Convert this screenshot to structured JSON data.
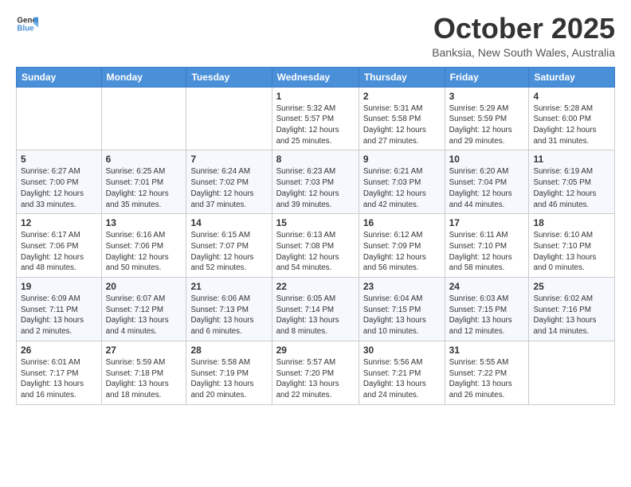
{
  "header": {
    "logo_text_general": "General",
    "logo_text_blue": "Blue",
    "month": "October 2025",
    "location": "Banksia, New South Wales, Australia"
  },
  "days_of_week": [
    "Sunday",
    "Monday",
    "Tuesday",
    "Wednesday",
    "Thursday",
    "Friday",
    "Saturday"
  ],
  "weeks": [
    {
      "days": [
        {
          "num": "",
          "info": ""
        },
        {
          "num": "",
          "info": ""
        },
        {
          "num": "",
          "info": ""
        },
        {
          "num": "1",
          "info": "Sunrise: 5:32 AM\nSunset: 5:57 PM\nDaylight: 12 hours\nand 25 minutes."
        },
        {
          "num": "2",
          "info": "Sunrise: 5:31 AM\nSunset: 5:58 PM\nDaylight: 12 hours\nand 27 minutes."
        },
        {
          "num": "3",
          "info": "Sunrise: 5:29 AM\nSunset: 5:59 PM\nDaylight: 12 hours\nand 29 minutes."
        },
        {
          "num": "4",
          "info": "Sunrise: 5:28 AM\nSunset: 6:00 PM\nDaylight: 12 hours\nand 31 minutes."
        }
      ]
    },
    {
      "days": [
        {
          "num": "5",
          "info": "Sunrise: 6:27 AM\nSunset: 7:00 PM\nDaylight: 12 hours\nand 33 minutes."
        },
        {
          "num": "6",
          "info": "Sunrise: 6:25 AM\nSunset: 7:01 PM\nDaylight: 12 hours\nand 35 minutes."
        },
        {
          "num": "7",
          "info": "Sunrise: 6:24 AM\nSunset: 7:02 PM\nDaylight: 12 hours\nand 37 minutes."
        },
        {
          "num": "8",
          "info": "Sunrise: 6:23 AM\nSunset: 7:03 PM\nDaylight: 12 hours\nand 39 minutes."
        },
        {
          "num": "9",
          "info": "Sunrise: 6:21 AM\nSunset: 7:03 PM\nDaylight: 12 hours\nand 42 minutes."
        },
        {
          "num": "10",
          "info": "Sunrise: 6:20 AM\nSunset: 7:04 PM\nDaylight: 12 hours\nand 44 minutes."
        },
        {
          "num": "11",
          "info": "Sunrise: 6:19 AM\nSunset: 7:05 PM\nDaylight: 12 hours\nand 46 minutes."
        }
      ]
    },
    {
      "days": [
        {
          "num": "12",
          "info": "Sunrise: 6:17 AM\nSunset: 7:06 PM\nDaylight: 12 hours\nand 48 minutes."
        },
        {
          "num": "13",
          "info": "Sunrise: 6:16 AM\nSunset: 7:06 PM\nDaylight: 12 hours\nand 50 minutes."
        },
        {
          "num": "14",
          "info": "Sunrise: 6:15 AM\nSunset: 7:07 PM\nDaylight: 12 hours\nand 52 minutes."
        },
        {
          "num": "15",
          "info": "Sunrise: 6:13 AM\nSunset: 7:08 PM\nDaylight: 12 hours\nand 54 minutes."
        },
        {
          "num": "16",
          "info": "Sunrise: 6:12 AM\nSunset: 7:09 PM\nDaylight: 12 hours\nand 56 minutes."
        },
        {
          "num": "17",
          "info": "Sunrise: 6:11 AM\nSunset: 7:10 PM\nDaylight: 12 hours\nand 58 minutes."
        },
        {
          "num": "18",
          "info": "Sunrise: 6:10 AM\nSunset: 7:10 PM\nDaylight: 13 hours\nand 0 minutes."
        }
      ]
    },
    {
      "days": [
        {
          "num": "19",
          "info": "Sunrise: 6:09 AM\nSunset: 7:11 PM\nDaylight: 13 hours\nand 2 minutes."
        },
        {
          "num": "20",
          "info": "Sunrise: 6:07 AM\nSunset: 7:12 PM\nDaylight: 13 hours\nand 4 minutes."
        },
        {
          "num": "21",
          "info": "Sunrise: 6:06 AM\nSunset: 7:13 PM\nDaylight: 13 hours\nand 6 minutes."
        },
        {
          "num": "22",
          "info": "Sunrise: 6:05 AM\nSunset: 7:14 PM\nDaylight: 13 hours\nand 8 minutes."
        },
        {
          "num": "23",
          "info": "Sunrise: 6:04 AM\nSunset: 7:15 PM\nDaylight: 13 hours\nand 10 minutes."
        },
        {
          "num": "24",
          "info": "Sunrise: 6:03 AM\nSunset: 7:15 PM\nDaylight: 13 hours\nand 12 minutes."
        },
        {
          "num": "25",
          "info": "Sunrise: 6:02 AM\nSunset: 7:16 PM\nDaylight: 13 hours\nand 14 minutes."
        }
      ]
    },
    {
      "days": [
        {
          "num": "26",
          "info": "Sunrise: 6:01 AM\nSunset: 7:17 PM\nDaylight: 13 hours\nand 16 minutes."
        },
        {
          "num": "27",
          "info": "Sunrise: 5:59 AM\nSunset: 7:18 PM\nDaylight: 13 hours\nand 18 minutes."
        },
        {
          "num": "28",
          "info": "Sunrise: 5:58 AM\nSunset: 7:19 PM\nDaylight: 13 hours\nand 20 minutes."
        },
        {
          "num": "29",
          "info": "Sunrise: 5:57 AM\nSunset: 7:20 PM\nDaylight: 13 hours\nand 22 minutes."
        },
        {
          "num": "30",
          "info": "Sunrise: 5:56 AM\nSunset: 7:21 PM\nDaylight: 13 hours\nand 24 minutes."
        },
        {
          "num": "31",
          "info": "Sunrise: 5:55 AM\nSunset: 7:22 PM\nDaylight: 13 hours\nand 26 minutes."
        },
        {
          "num": "",
          "info": ""
        }
      ]
    }
  ]
}
